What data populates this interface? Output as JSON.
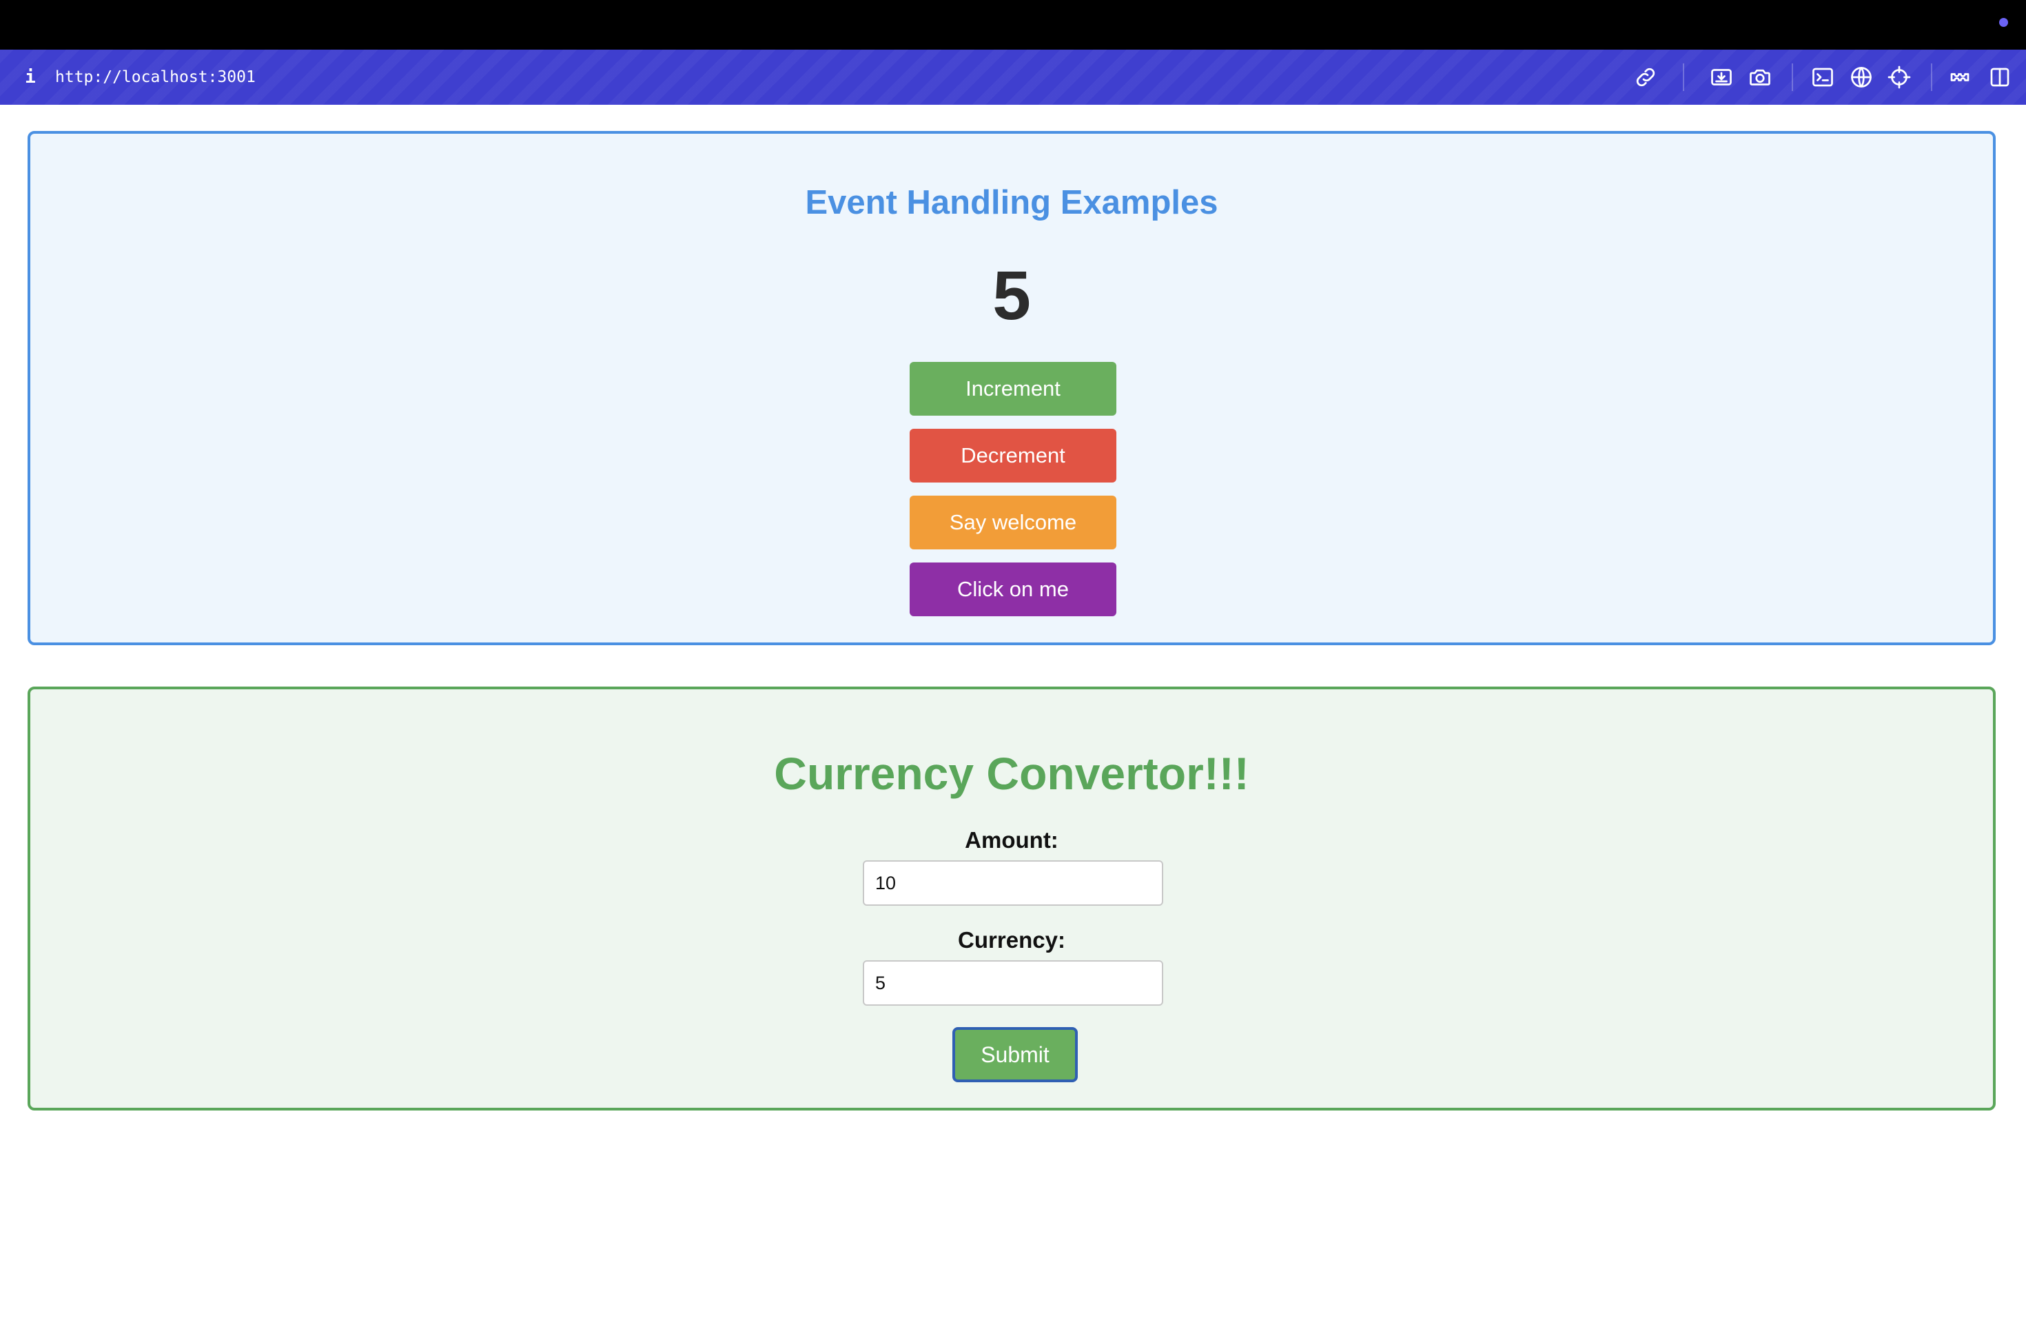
{
  "browser": {
    "url": "http://localhost:3001",
    "info_icon": "i",
    "icons": [
      "link-icon",
      "screenshot-area-icon",
      "camera-icon",
      "terminal-icon",
      "globe-icon",
      "crosshair-icon",
      "extension-icon",
      "split-view-icon"
    ],
    "accent": "#3f3fcf"
  },
  "events": {
    "title": "Event Handling Examples",
    "count": "5",
    "buttons": {
      "increment": "Increment",
      "decrement": "Decrement",
      "welcome": "Say welcome",
      "click": "Click on me"
    },
    "colors": {
      "border": "#4a90e2",
      "increment": "#6aaf5e",
      "decrement": "#e15444",
      "welcome": "#f29d38",
      "click": "#8e2fa6"
    }
  },
  "converter": {
    "title": "Currency Convertor!!!",
    "amount_label": "Amount:",
    "amount_value": "10",
    "currency_label": "Currency:",
    "currency_value": "5",
    "submit_label": "Submit",
    "colors": {
      "border": "#5aa65a",
      "submit": "#6aaf5e"
    }
  }
}
